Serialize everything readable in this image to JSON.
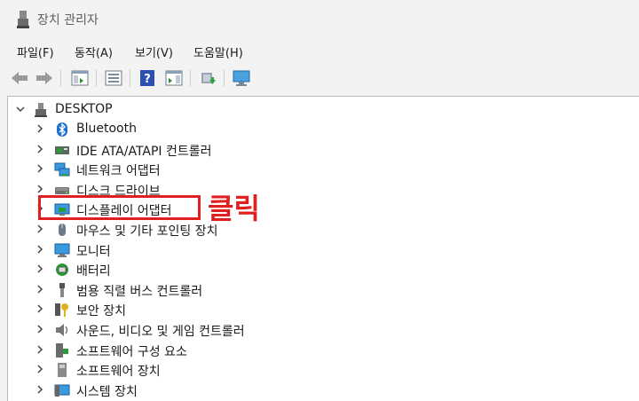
{
  "window": {
    "title": "장치 관리자"
  },
  "menu": [
    "파일(F)",
    "동작(A)",
    "보기(V)",
    "도움말(H)"
  ],
  "toolbar": {
    "buttons": [
      "back-icon",
      "forward-icon",
      "properties-panel-icon",
      "list-view-icon",
      "help-icon",
      "details-view-icon",
      "update-driver-icon",
      "monitor-scan-icon"
    ]
  },
  "tree": {
    "root": "DESKTOP",
    "items": [
      {
        "label": "Bluetooth",
        "icon": "bluetooth-icon"
      },
      {
        "label": "IDE ATA/ATAPI 컨트롤러",
        "icon": "ide-controller-icon"
      },
      {
        "label": "네트워크 어댑터",
        "icon": "network-adapter-icon"
      },
      {
        "label": "디스크 드라이브",
        "icon": "disk-drive-icon"
      },
      {
        "label": "디스플레이 어댑터",
        "icon": "display-adapter-icon"
      },
      {
        "label": "마우스 및 기타 포인팅 장치",
        "icon": "mouse-icon"
      },
      {
        "label": "모니터",
        "icon": "monitor-icon"
      },
      {
        "label": "배터리",
        "icon": "battery-icon"
      },
      {
        "label": "범용 직렬 버스 컨트롤러",
        "icon": "usb-icon"
      },
      {
        "label": "보안 장치",
        "icon": "security-device-icon"
      },
      {
        "label": "사운드, 비디오 및 게임 컨트롤러",
        "icon": "sound-icon"
      },
      {
        "label": "소프트웨어 구성 요소",
        "icon": "software-component-icon"
      },
      {
        "label": "소프트웨어 장치",
        "icon": "software-device-icon"
      },
      {
        "label": "시스템 장치",
        "icon": "system-device-icon"
      }
    ]
  },
  "annotation": {
    "text": "클릭",
    "color": "#e02020"
  }
}
